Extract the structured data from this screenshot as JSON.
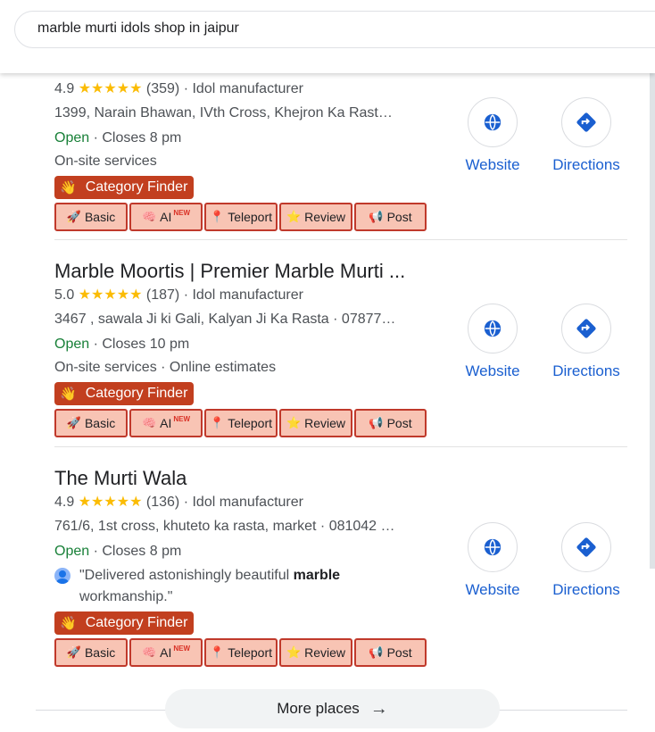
{
  "search": {
    "query": "marble murti idols shop in jaipur"
  },
  "listings": [
    {
      "name": "",
      "rating": "4.9",
      "stars": "★★★★★",
      "reviews": "(359)",
      "category": "Idol manufacturer",
      "address": "1399, Narain Bhawan, IVth Cross, Khejron Ka Rast…",
      "open": "Open",
      "hours": "Closes 8 pm",
      "services": "On-site services"
    },
    {
      "name": "Marble Moortis | Premier Marble Murti ...",
      "rating": "5.0",
      "stars": "★★★★★",
      "reviews": "(187)",
      "category": "Idol manufacturer",
      "address": "3467 , sawala Ji ki Gali, Kalyan Ji Ka Rasta · 07877…",
      "open": "Open",
      "hours": "Closes 10 pm",
      "services": "On-site services · Online estimates"
    },
    {
      "name": "The Murti Wala",
      "rating": "4.9",
      "stars": "★★★★★",
      "reviews": "(136)",
      "category": "Idol manufacturer",
      "address": "761/6, 1st cross, khuteto ka rasta, market · 081042 …",
      "open": "Open",
      "hours": "Closes 8 pm",
      "review_pre": "\"Delivered astonishingly beautiful ",
      "review_bold": "marble",
      "review_post": "workmanship.\""
    }
  ],
  "badge": {
    "label": "Category Finder",
    "icon": "👋"
  },
  "ext_buttons": {
    "basic": "Basic",
    "ai": "AI",
    "ai_new": "NEW",
    "teleport": "Teleport",
    "review": "Review",
    "post": "Post"
  },
  "actions": {
    "website": "Website",
    "directions": "Directions"
  },
  "sep": "·",
  "more": {
    "label": "More places",
    "arrow": "→"
  },
  "colors": {
    "open": "#188038",
    "star": "#fbbc04",
    "link": "#1a5fd0",
    "badge": "#c23f1f",
    "ext_bg": "#f8c4b4",
    "ext_border": "#c0392b"
  }
}
